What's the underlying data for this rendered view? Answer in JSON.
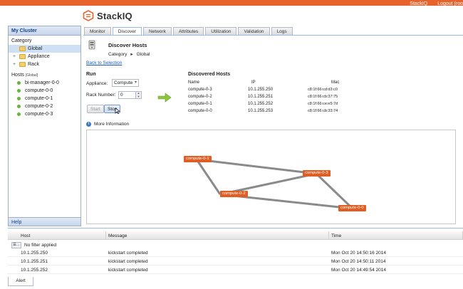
{
  "header": {
    "logo_text": "StackIQ",
    "links": [
      "StackIQ",
      "Logout (roo"
    ]
  },
  "left_panel": {
    "title": "My Cluster",
    "category_label": "Category",
    "tree": [
      {
        "label": "Global",
        "expander": "",
        "selected": true
      },
      {
        "label": "Appliance",
        "expander": "+",
        "selected": false
      },
      {
        "label": "Rack",
        "expander": "+",
        "selected": false
      }
    ],
    "hosts_label": "Hosts",
    "hosts_scope": "[Global]",
    "hosts": [
      "bi-manager-0-0",
      "compute-0-0",
      "compute-0-1",
      "compute-0-2",
      "compute-0-3"
    ],
    "help_label": "Help"
  },
  "tabs": [
    "Monitor",
    "Discover",
    "Network",
    "Attributes",
    "Utilization",
    "Validation",
    "Logs"
  ],
  "active_tab": "Discover",
  "discover": {
    "title": "Discover Hosts",
    "category_label": "Category",
    "category_value": "Global",
    "back_link": "Back to Selection",
    "run_title": "Run",
    "appliance_label": "Appliance:",
    "appliance_value": "Compute",
    "rack_label": "Rack Number:",
    "rack_value": "0",
    "start_label": "Start",
    "stop_label": "Stop",
    "hosts_title": "Discovered Hosts",
    "columns": [
      "Name",
      "IP",
      "Mac"
    ],
    "rows": [
      [
        "compute-0-3",
        "10.1.255.250",
        "c8:1f:66:cd:d3:c0"
      ],
      [
        "compute-0-2",
        "10.1.255.251",
        "c8:1f:66:cb:37:75"
      ],
      [
        "compute-0-1",
        "10.1.255.252",
        "c8:1f:66:ce:e5:7d"
      ],
      [
        "compute-0-0",
        "10.1.255.253",
        "c8:1f:66:cb:33:74"
      ]
    ],
    "more_info": "More Information",
    "graph_nodes": [
      "compute-0-1",
      "compute-0-3",
      "compute-0-2",
      "compute-0-0"
    ]
  },
  "bottom_grid": {
    "columns": [
      "Host",
      "Message",
      "Time"
    ],
    "filter_text": "No filter applied",
    "rows": [
      [
        "10.1.255.250",
        "kickstart completed",
        "Mon Oct 20 14:50:16 2014"
      ],
      [
        "10.1.255.251",
        "kickstart completed",
        "Mon Oct 20 14:50:11 2014"
      ],
      [
        "10.1.255.252",
        "kickstart completed",
        "Mon Oct 20 14:49:54 2014"
      ]
    ],
    "alert_label": "Alert"
  },
  "colors": {
    "brand": "#e8632c",
    "node": "#e05e24",
    "link": "#1b57c9"
  }
}
